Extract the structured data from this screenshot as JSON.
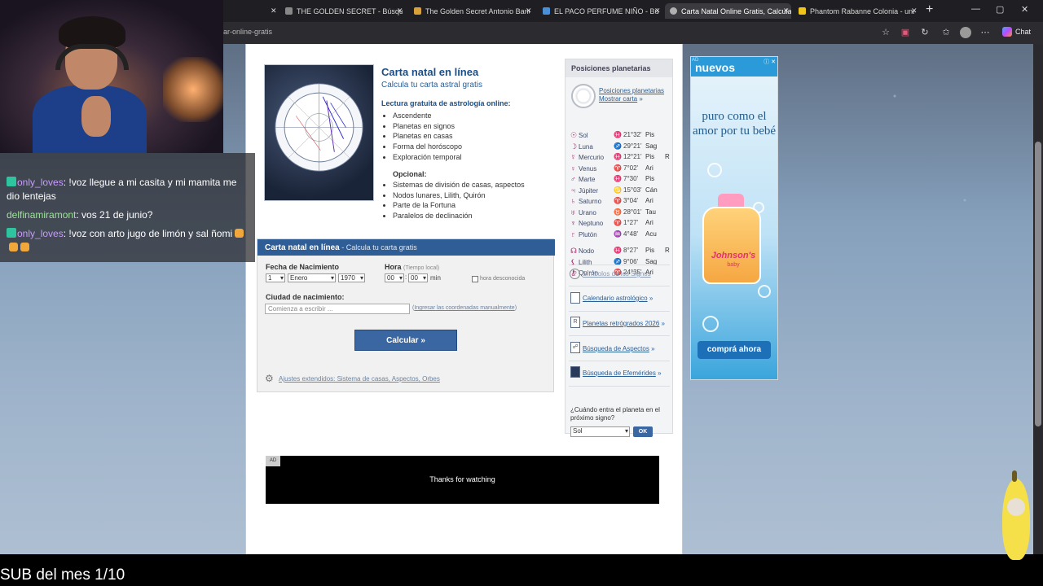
{
  "browser": {
    "tabs": [
      {
        "title": "THE GOLDEN SECRET - Búsqueda",
        "color": "#888888",
        "active": false
      },
      {
        "title": "The Golden Secret Antonio Bande",
        "color": "#d8a13a",
        "active": false
      },
      {
        "title": "EL PACO PERFUME NIÑO - Búsqu",
        "color": "#4a90d9",
        "active": false
      },
      {
        "title": "Carta Natal Online Gratis, Calcula",
        "color": "#b0b0b0",
        "active": true
      },
      {
        "title": "Phantom Rabanne Colonia - una f",
        "color": "#f0c419",
        "active": false
      }
    ],
    "url": "ar-online-gratis",
    "chat_label": "Chat"
  },
  "intro": {
    "title": "Carta natal en línea",
    "subtitle": "Calcula tu carta astral gratis",
    "lectura_heading": "Lectura gratuita de astrología online:",
    "features": [
      "Ascendente",
      "Planetas en signos",
      "Planetas en casas",
      "Forma del horóscopo",
      "Exploración temporal"
    ],
    "opcional_heading": "Opcional:",
    "optional_features": [
      "Sistemas de división de casas, aspectos",
      "Nodos lunares, Lilith, Quirón",
      "Parte de la Fortuna",
      "Paralelos de declinación"
    ]
  },
  "form": {
    "header_title": "Carta natal en línea",
    "header_sub": " - Calcula tu carta gratis",
    "fecha_label": "Fecha de Nacimiento",
    "day": "1",
    "month": "Enero",
    "year": "1970",
    "hora_label": "Hora",
    "hora_hint": "(Tiempo local)",
    "hour": "00",
    "minute": "00",
    "min_label": "min",
    "unknown_label": "hora desconocida",
    "ciudad_label": "Ciudad de nacimiento:",
    "city_placeholder": "Comienza a escribir ...",
    "manual_link": "Ingresar las coordenadas manualmente",
    "calc_button": "Calcular »",
    "ajustes_link": "Ajustes extendidos: Sistema de casas, Aspectos, Orbes"
  },
  "sidebar": {
    "heading": "Posiciones planetarias",
    "link1": "Posiciones planetarias",
    "link2": "Mostrar carta",
    "planets": [
      {
        "glyph": "☉",
        "name": "Sol",
        "sglyph": "♓",
        "pos": "21°32'",
        "sign": "Pis",
        "retro": ""
      },
      {
        "glyph": "☽",
        "name": "Luna",
        "sglyph": "♐",
        "pos": "29°21'",
        "sign": "Sag",
        "retro": ""
      },
      {
        "glyph": "☿",
        "name": "Mercurio",
        "sglyph": "♓",
        "pos": "12°21'",
        "sign": "Pis",
        "retro": "R"
      },
      {
        "glyph": "♀",
        "name": "Venus",
        "sglyph": "♈",
        "pos": "7°02'",
        "sign": "Ari",
        "retro": ""
      },
      {
        "glyph": "♂",
        "name": "Marte",
        "sglyph": "♓",
        "pos": "7°30'",
        "sign": "Pis",
        "retro": ""
      },
      {
        "glyph": "♃",
        "name": "Júpiter",
        "sglyph": "♋",
        "pos": "15°03'",
        "sign": "Cán",
        "retro": ""
      },
      {
        "glyph": "♄",
        "name": "Saturno",
        "sglyph": "♈",
        "pos": "3°04'",
        "sign": "Ari",
        "retro": ""
      },
      {
        "glyph": "♅",
        "name": "Urano",
        "sglyph": "♉",
        "pos": "28°01'",
        "sign": "Tau",
        "retro": ""
      },
      {
        "glyph": "♆",
        "name": "Neptuno",
        "sglyph": "♈",
        "pos": "1°27'",
        "sign": "Ari",
        "retro": ""
      },
      {
        "glyph": "♇",
        "name": "Plutón",
        "sglyph": "♒",
        "pos": "4°48'",
        "sign": "Acu",
        "retro": ""
      },
      {
        "glyph": "☊",
        "name": "Nodo",
        "sglyph": "♓",
        "pos": "8°27'",
        "sign": "Pis",
        "retro": "R"
      },
      {
        "glyph": "⚸",
        "name": "Lilith",
        "sglyph": "♐",
        "pos": "9°06'",
        "sign": "Sag",
        "retro": ""
      },
      {
        "glyph": "⚷",
        "name": "Quirón",
        "sglyph": "♈",
        "pos": "24°35'",
        "sign": "Ari",
        "retro": ""
      }
    ],
    "simbolos": "Símbolos de los Signos",
    "calendario": "Calendario astrológico",
    "retrogrados": "Planetas retrógrados 2026",
    "aspectos": "Búsqueda de Aspectos",
    "efemerides": "Búsqueda de Efemérides",
    "question": "¿Cuándo entra el planeta en el próximo signo?",
    "planet_select": "Sol",
    "ok_label": "OK"
  },
  "ads": {
    "bottom_tag": "AD",
    "bottom_text": "Thanks for watching",
    "right_tag": "AD",
    "right_brand": "nuevos",
    "right_slogan": "puro como el amor por tu bebé",
    "product_brand": "Johnson's",
    "product_sub": "baby",
    "buy_button": "comprá ahora"
  },
  "stream": {
    "messages": [
      {
        "user": "only_loves",
        "badge": true,
        "text": " !voz llegue a mi casita y mi mamita me dio lentejas",
        "emotes": 0
      },
      {
        "user": "delfinamiramont",
        "badge": false,
        "text": " vos 21 de junio?",
        "emotes": 0
      },
      {
        "user": "only_loves",
        "badge": true,
        "text": " !voz con arto jugo de limón y sal ñomi",
        "emotes": 3
      }
    ],
    "sub_text": "SUB del mes 1/10"
  },
  "colors": {
    "accent": "#2f5d95",
    "link": "#2a5f96",
    "glyph": "#a02b6a"
  }
}
